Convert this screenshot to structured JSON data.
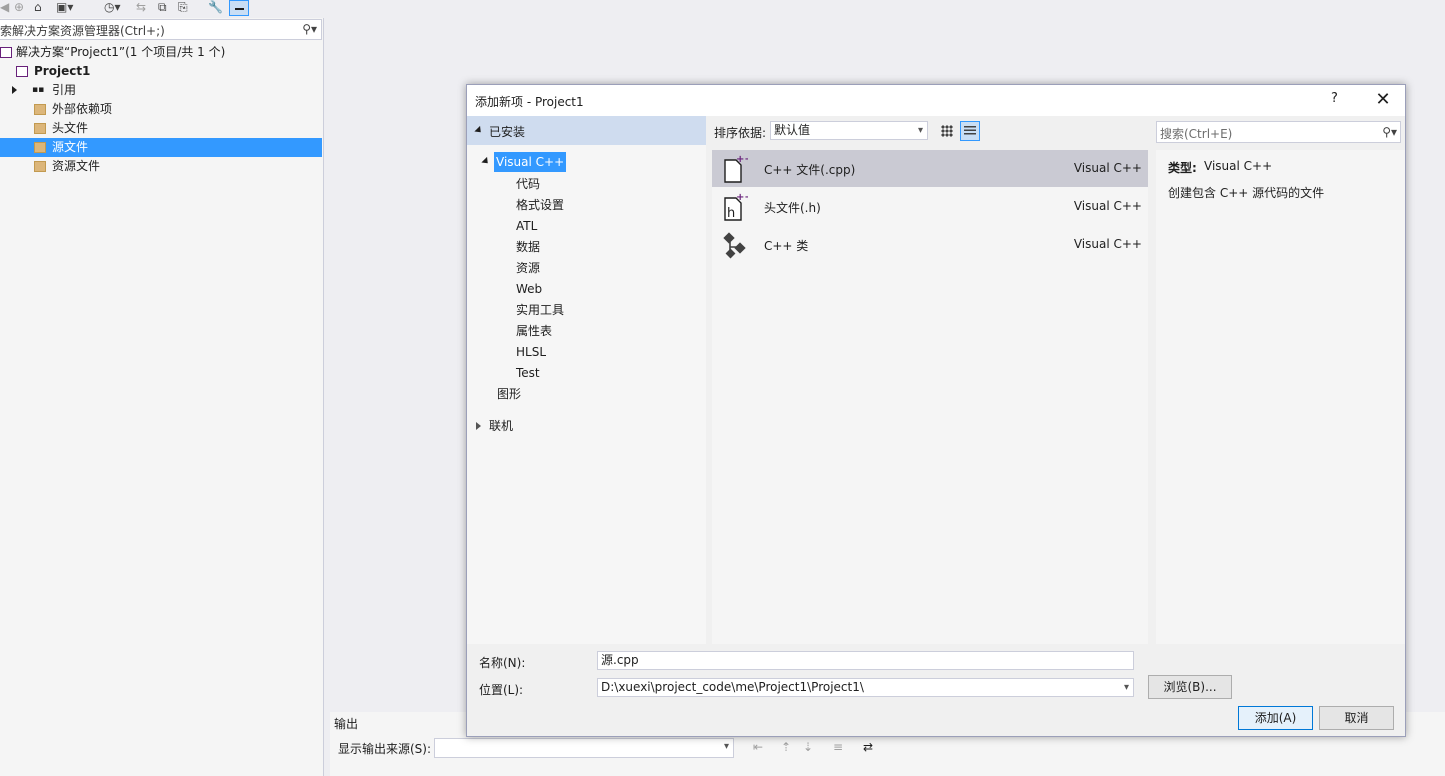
{
  "explorer": {
    "search_placeholder": "索解决方案资源管理器(Ctrl+;)",
    "tree": [
      {
        "label": "解决方案“Project1”(1 个项目/共 1 个)"
      },
      {
        "label": "Project1"
      },
      {
        "label": "引用"
      },
      {
        "label": "外部依赖项"
      },
      {
        "label": "头文件"
      },
      {
        "label": "源文件",
        "selected": true
      },
      {
        "label": "资源文件"
      }
    ]
  },
  "output": {
    "title": "输出",
    "source_label": "显示输出来源(S):",
    "source_value": ""
  },
  "dialog": {
    "title": "添加新项 - Project1",
    "help": "?",
    "close": "✕",
    "installed": "已安装",
    "categories": {
      "visual_cpp": "Visual C++",
      "children": [
        "代码",
        "格式设置",
        "ATL",
        "数据",
        "资源",
        "Web",
        "实用工具",
        "属性表",
        "HLSL",
        "Test"
      ],
      "graphics": "图形",
      "online": "联机"
    },
    "sort_label": "排序依据:",
    "sort_value": "默认值",
    "templates": [
      {
        "name": "C++ 文件(.cpp)",
        "lang": "Visual C++",
        "icon": "cpp-file-icon",
        "selected": true
      },
      {
        "name": "头文件(.h)",
        "lang": "Visual C++",
        "icon": "header-file-icon"
      },
      {
        "name": "C++ 类",
        "lang": "Visual C++",
        "icon": "cpp-class-icon"
      }
    ],
    "search_placeholder": "搜索(Ctrl+E)",
    "description": {
      "type_label": "类型:",
      "type_value": "Visual C++",
      "text": "创建包含 C++ 源代码的文件"
    },
    "name_label": "名称(N):",
    "name_value": "源.cpp",
    "location_label": "位置(L):",
    "location_value": "D:\\xuexi\\project_code\\me\\Project1\\Project1\\",
    "browse_label": "浏览(B)...",
    "add_label": "添加(A)",
    "cancel_label": "取消"
  },
  "colors": {
    "accent": "#3399ff",
    "selected_bg": "#cacad3",
    "installed_header": "#cfdcef",
    "vs_purple": "#68217a"
  }
}
